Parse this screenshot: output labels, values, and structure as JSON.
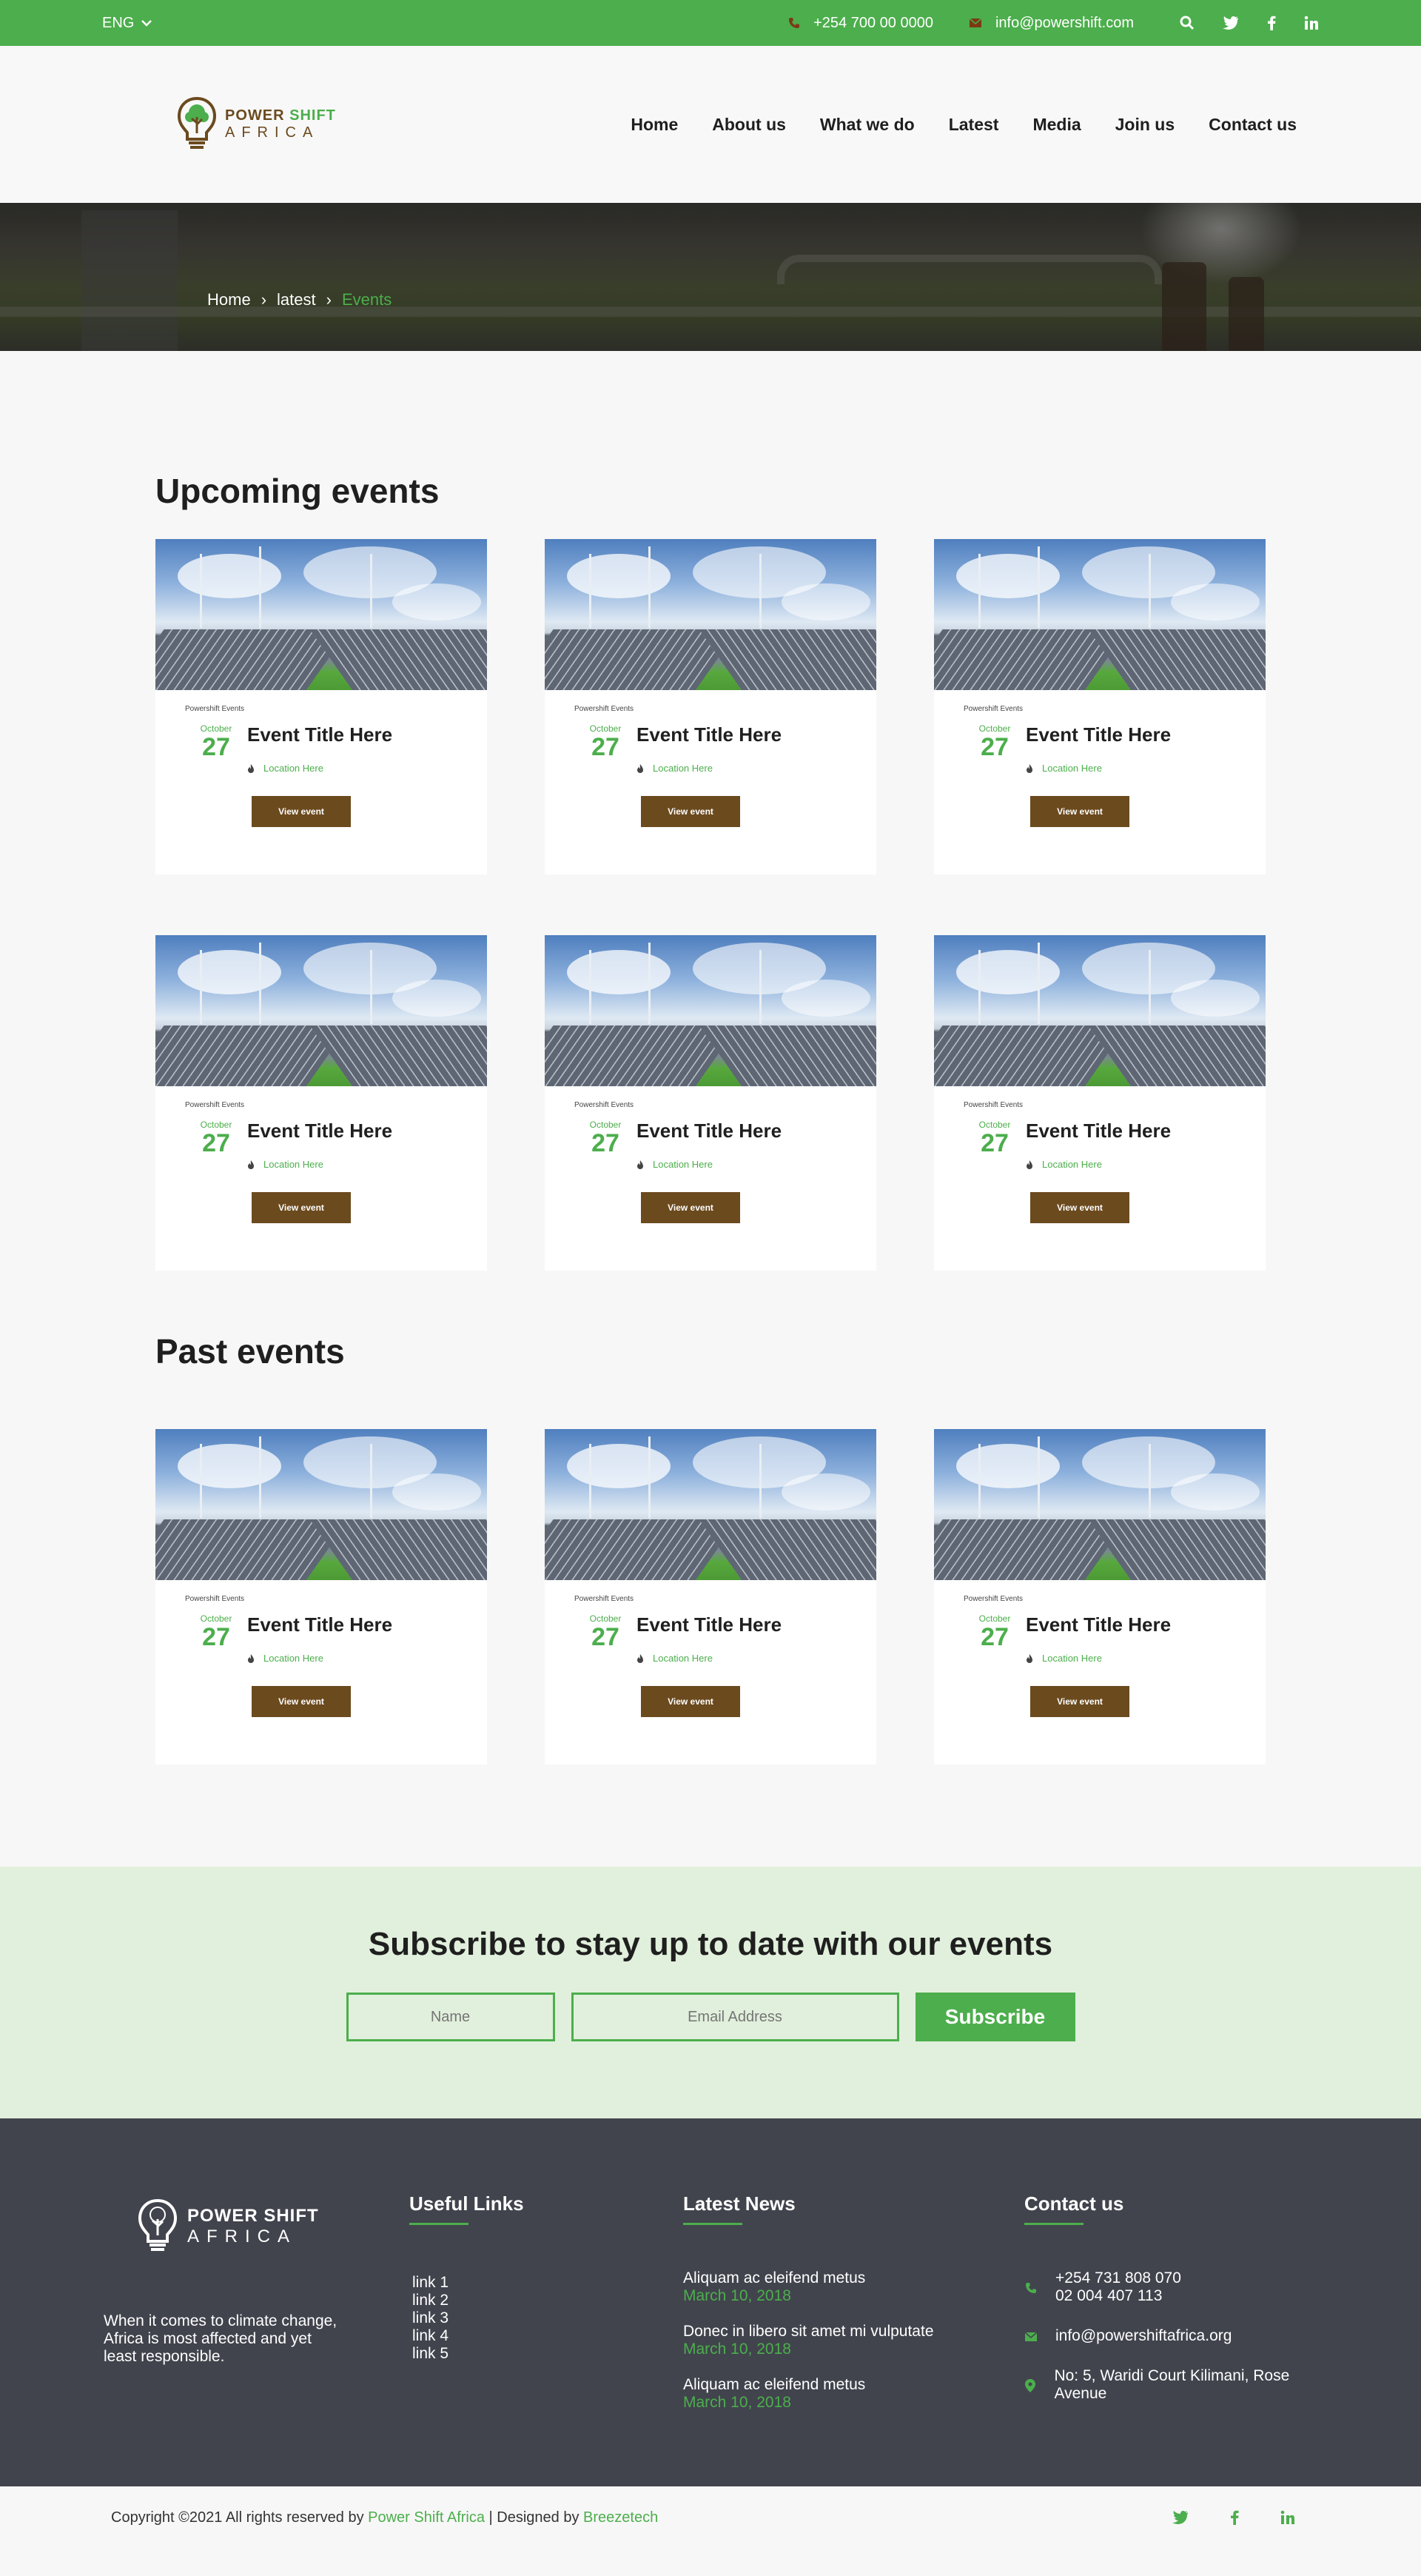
{
  "topbar": {
    "lang": "ENG",
    "phone": "+254 700 00 0000",
    "email": "info@powershift.com",
    "icons": [
      "search-icon",
      "twitter-icon",
      "facebook-icon",
      "linkedin-icon"
    ]
  },
  "brand": {
    "name_part1": "POWER",
    "name_part2": "SHIFT",
    "name_line2": "AFRICA"
  },
  "nav": [
    "Home",
    "About us",
    "What we do",
    "Latest",
    "Media",
    "Join us",
    "Contact us"
  ],
  "breadcrumb": [
    "Home",
    "latest",
    "Events"
  ],
  "upcoming": {
    "title": "Upcoming events",
    "cards": [
      {
        "category": "Powershift Events",
        "month": "October",
        "day": "27",
        "title": "Event Title Here",
        "location": "Location Here",
        "button": "View event"
      },
      {
        "category": "Powershift Events",
        "month": "October",
        "day": "27",
        "title": "Event Title Here",
        "location": "Location Here",
        "button": "View event"
      },
      {
        "category": "Powershift Events",
        "month": "October",
        "day": "27",
        "title": "Event Title Here",
        "location": "Location Here",
        "button": "View event"
      },
      {
        "category": "Powershift Events",
        "month": "October",
        "day": "27",
        "title": "Event Title Here",
        "location": "Location Here",
        "button": "View event"
      },
      {
        "category": "Powershift Events",
        "month": "October",
        "day": "27",
        "title": "Event Title Here",
        "location": "Location Here",
        "button": "View event"
      },
      {
        "category": "Powershift Events",
        "month": "October",
        "day": "27",
        "title": "Event Title Here",
        "location": "Location Here",
        "button": "View event"
      }
    ]
  },
  "past": {
    "title": "Past events",
    "cards": [
      {
        "category": "Powershift Events",
        "month": "October",
        "day": "27",
        "title": "Event Title Here",
        "location": "Location Here",
        "button": "View event"
      },
      {
        "category": "Powershift Events",
        "month": "October",
        "day": "27",
        "title": "Event Title Here",
        "location": "Location Here",
        "button": "View event"
      },
      {
        "category": "Powershift Events",
        "month": "October",
        "day": "27",
        "title": "Event Title Here",
        "location": "Location Here",
        "button": "View event"
      }
    ]
  },
  "subscribe": {
    "title": "Subscribe to stay up to date with our events",
    "name_placeholder": "Name",
    "email_placeholder": "Email Address",
    "button": "Subscribe"
  },
  "footer": {
    "brand_line1": "POWER SHIFT",
    "brand_line2": "AFRICA",
    "tagline": "When it comes to climate change, Africa is most affected and yet least responsible.",
    "useful_links_title": "Useful Links",
    "links": [
      "link 1",
      "link 2",
      "link 3",
      "link 4",
      "link 5"
    ],
    "news_title": "Latest News",
    "news": [
      {
        "headline": "Aliquam ac eleifend metus",
        "date": "March 10, 2018"
      },
      {
        "headline": "Donec in libero sit amet mi vulputate",
        "date": "March 10, 2018"
      },
      {
        "headline": "Aliquam ac eleifend metus",
        "date": "March 10, 2018"
      }
    ],
    "contact_title": "Contact us",
    "phone1": "+254 731 808 070",
    "phone2": "02 004 407 113",
    "email": "info@powershiftafrica.org",
    "address": "No: 5, Waridi Court Kilimani, Rose Avenue"
  },
  "copyright": {
    "prefix": "Copyright ©2021 All rights reserved by",
    "org": "Power Shift Africa",
    "mid": "| Designed by",
    "designer": "Breezetech"
  },
  "colors": {
    "accent": "#4cae4c",
    "brown": "#6b4a1e",
    "footer_bg": "#41444d",
    "subscribe_bg": "#e1f0dc"
  }
}
